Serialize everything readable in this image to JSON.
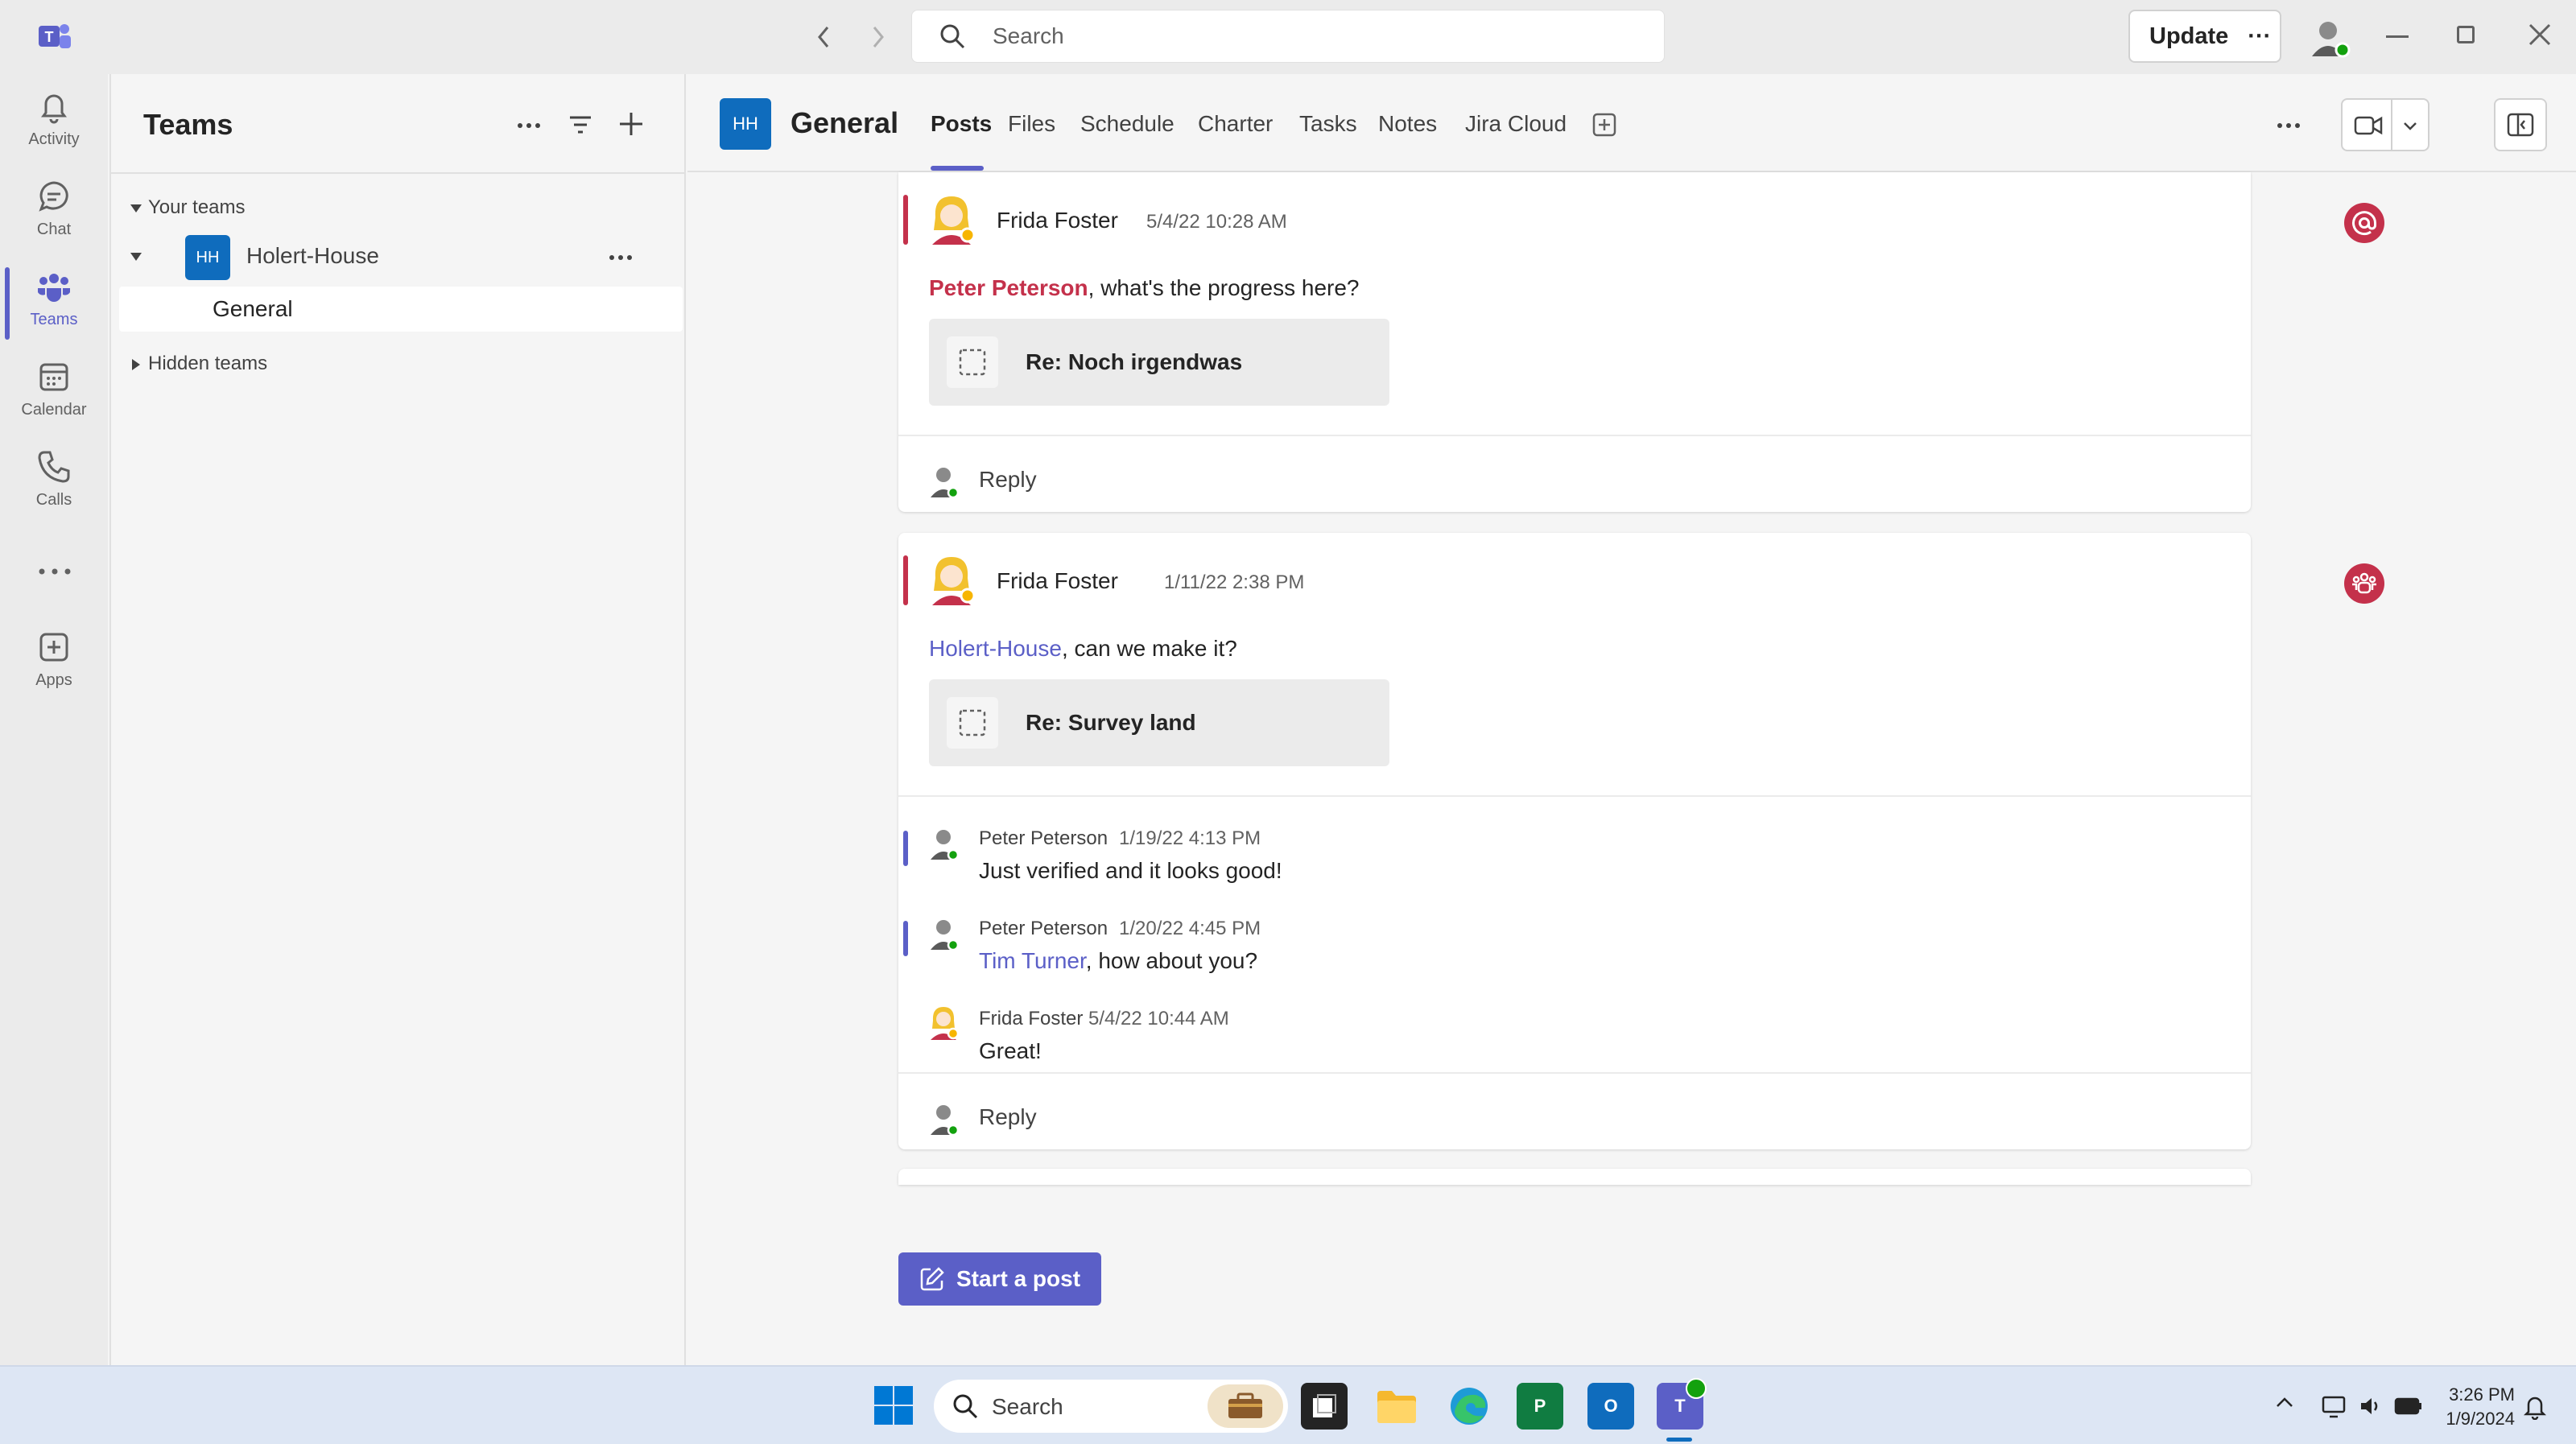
{
  "titlebar": {
    "search_placeholder": "Search",
    "update_label": "Update",
    "more": "···"
  },
  "rail": [
    {
      "label": "Activity",
      "icon": "bell-icon"
    },
    {
      "label": "Chat",
      "icon": "chat-icon"
    },
    {
      "label": "Teams",
      "icon": "teams-icon",
      "active": true
    },
    {
      "label": "Calendar",
      "icon": "calendar-icon"
    },
    {
      "label": "Calls",
      "icon": "phone-icon"
    },
    {
      "label": "Apps",
      "icon": "apps-icon"
    }
  ],
  "teams_panel": {
    "title": "Teams",
    "your_teams": "Your teams",
    "team_initials": "HH",
    "team_name": "Holert-House",
    "channel": "General",
    "hidden_teams": "Hidden teams"
  },
  "channel": {
    "initials": "HH",
    "title": "General",
    "tabs": [
      "Posts",
      "Files",
      "Schedule",
      "Charter",
      "Tasks",
      "Notes",
      "Jira Cloud"
    ]
  },
  "posts": [
    {
      "author": "Frida Foster",
      "time": "5/4/22 10:28 AM",
      "mention": "Peter Peterson",
      "text": ", what's the progress here?",
      "attachment": "Re: Noch irgendwas",
      "reply": "Reply",
      "badge": "@"
    },
    {
      "author": "Frida Foster",
      "time": "1/11/22 2:38 PM",
      "mention": "Holert-House",
      "text": ", can we make it?",
      "attachment": "Re: Survey land",
      "reply": "Reply",
      "replies": [
        {
          "author": "Peter Peterson",
          "time": "1/19/22 4:13 PM",
          "text": "Just verified and it looks good!"
        },
        {
          "author": "Peter Peterson",
          "time": "1/20/22 4:45 PM",
          "mention": "Tim Turner",
          "text": ", how about you?"
        },
        {
          "author": "Frida Foster",
          "time": "5/4/22 10:44 AM",
          "text": "Great!"
        }
      ]
    }
  ],
  "start_post": "Start a post",
  "taskbar": {
    "search": "Search",
    "time": "3:26 PM",
    "date": "1/9/2024"
  },
  "colors": {
    "accent": "#5b5fc7",
    "mention_red": "#c4314b",
    "team_blue": "#0f6cbd"
  }
}
